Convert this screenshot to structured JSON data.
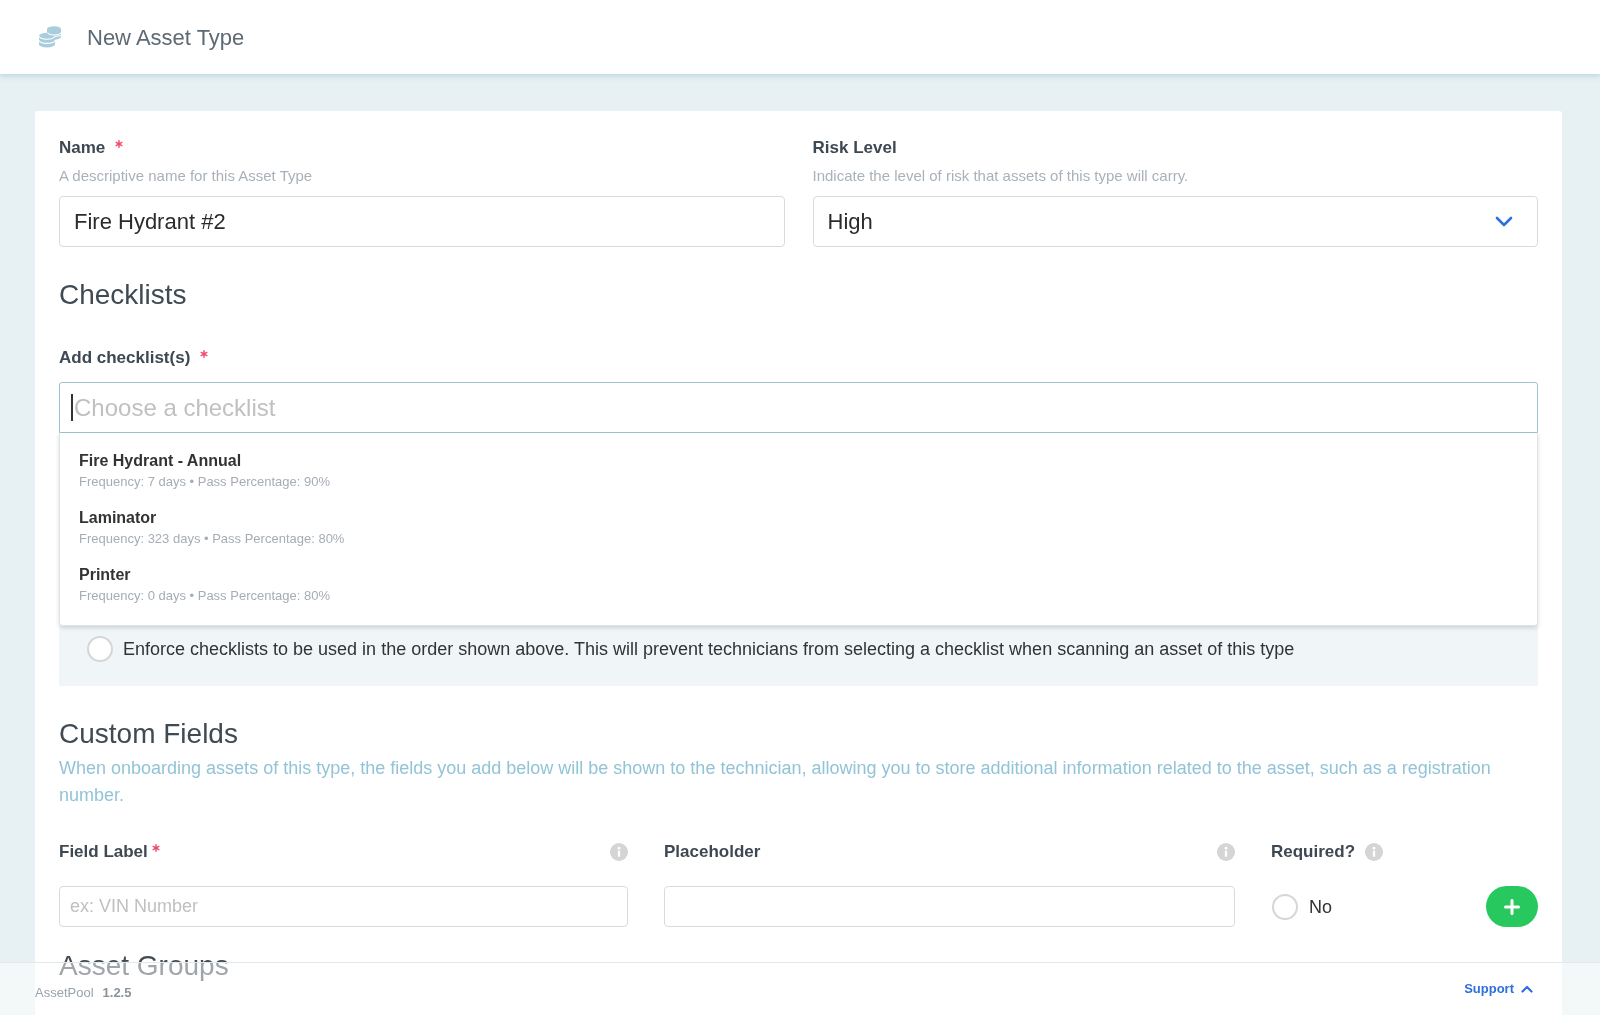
{
  "header": {
    "title": "New Asset Type"
  },
  "name_field": {
    "label": "Name",
    "required": true,
    "description": "A descriptive name for this Asset Type",
    "value": "Fire Hydrant #2"
  },
  "risk_level_field": {
    "label": "Risk Level",
    "required": false,
    "description": "Indicate the level of risk that assets of this type will carry.",
    "value": "High"
  },
  "checklists": {
    "heading": "Checklists",
    "label": "Add checklist(s)",
    "required": true,
    "placeholder": "Choose a checklist",
    "focused": true,
    "expanded": true,
    "options": [
      {
        "title": "Fire Hydrant - Annual",
        "details": "Frequency: 7 days • Pass Percentage: 90%"
      },
      {
        "title": "Laminator",
        "details": "Frequency: 323 days • Pass Percentage: 80%"
      },
      {
        "title": "Printer",
        "details": "Frequency: 0 days • Pass Percentage: 80%"
      }
    ],
    "enforce_order": {
      "label": "Enforce checklists to be used in the order shown above. This will prevent technicians from selecting a checklist when scanning an asset of this type",
      "checked": false
    }
  },
  "custom_fields": {
    "heading": "Custom Fields",
    "description": "When onboarding assets of this type, the fields you add below will be shown to the technician, allowing you to store additional information related to the asset, such as a registration number.",
    "columns": [
      {
        "kind": "text",
        "label": "Field Label",
        "required": true,
        "placeholder": "ex: VIN Number"
      },
      {
        "kind": "text",
        "label": "Placeholder",
        "required": false
      },
      {
        "kind": "toggle",
        "label": "Required?",
        "required": false,
        "option": "No",
        "checked": false
      }
    ]
  },
  "asset_groups": {
    "heading": "Asset Groups"
  },
  "footer": {
    "app_name": "AssetPool",
    "version": "1.2.5",
    "support_link": "Support"
  }
}
